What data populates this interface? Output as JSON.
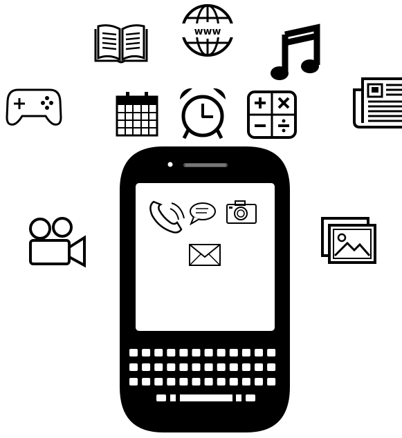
{
  "icons": {
    "globe": {
      "name": "globe-icon",
      "text": "www"
    },
    "book": {
      "name": "book-icon"
    },
    "music": {
      "name": "music-note-icon"
    },
    "gamepad": {
      "name": "gamepad-icon"
    },
    "calendar": {
      "name": "calendar-icon"
    },
    "alarm": {
      "name": "alarm-clock-icon"
    },
    "calculator": {
      "name": "calculator-icon"
    },
    "newspaper": {
      "name": "newspaper-icon"
    },
    "video_camera": {
      "name": "video-camera-icon"
    },
    "photos": {
      "name": "photo-gallery-icon"
    }
  },
  "phone": {
    "screen_apps": [
      "phone-call-icon",
      "chat-bubble-icon",
      "camera-icon",
      "envelope-icon"
    ],
    "keyboard_rows": 3,
    "keys_per_row": 12
  },
  "colors": {
    "ink": "#000000",
    "background": "#ffffff",
    "screen": "#ffffff"
  }
}
